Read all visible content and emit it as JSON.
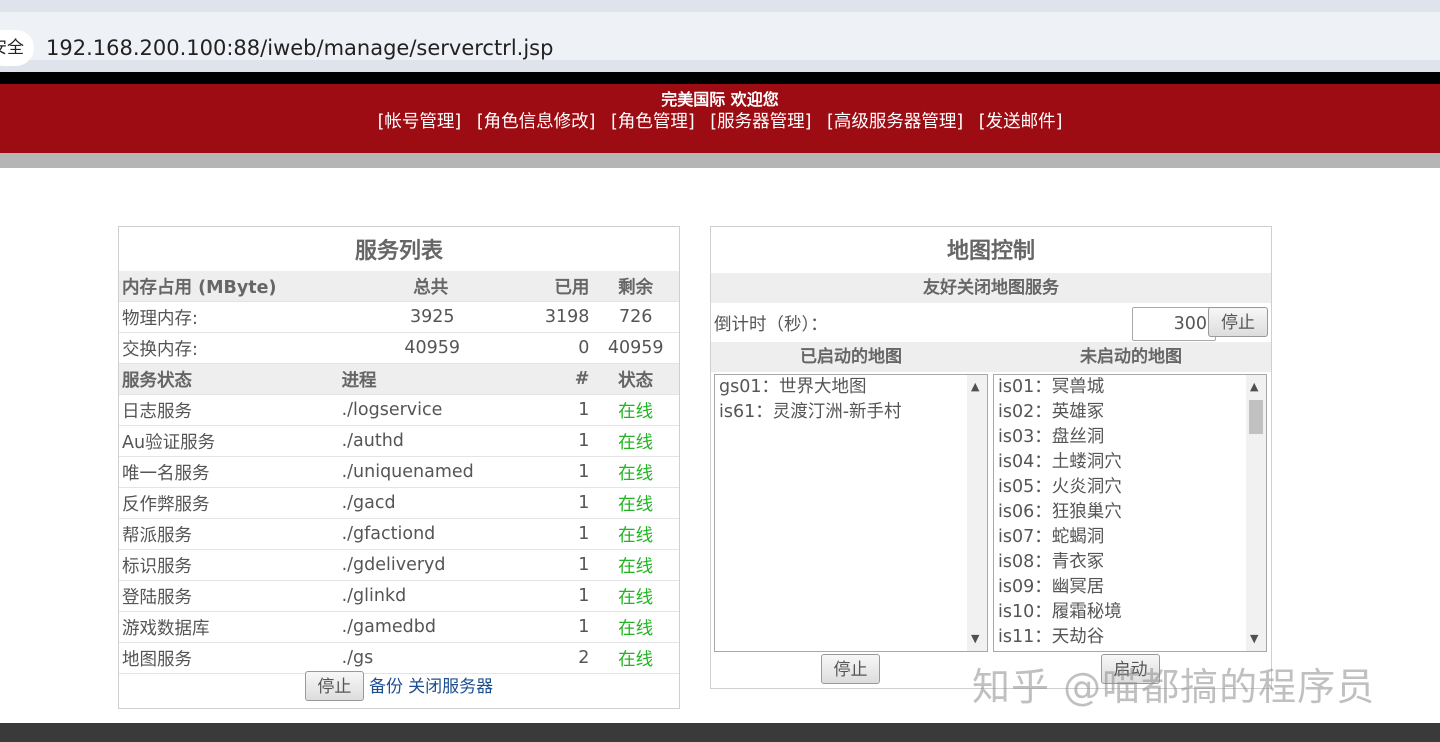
{
  "browser": {
    "secure_label": "安全",
    "url": "192.168.200.100:88/iweb/manage/serverctrl.jsp"
  },
  "header": {
    "welcome": "完美国际 欢迎您",
    "nav": [
      "[帐号管理]",
      "[角色信息修改]",
      "[角色管理]",
      "[服务器管理]",
      "[高级服务器管理]",
      "[发送邮件]"
    ]
  },
  "services": {
    "title": "服务列表",
    "memory_header": [
      "内存占用 (MByte)",
      "总共",
      "已用",
      "剩余"
    ],
    "memory_rows": [
      [
        "物理内存:",
        "3925",
        "3198",
        "726"
      ],
      [
        "交换内存:",
        "40959",
        "0",
        "40959"
      ]
    ],
    "status_header": [
      "服务状态",
      "进程",
      "#",
      "状态"
    ],
    "status_rows": [
      [
        "日志服务",
        "./logservice",
        "1",
        "在线"
      ],
      [
        "Au验证服务",
        "./authd",
        "1",
        "在线"
      ],
      [
        "唯一名服务",
        "./uniquenamed",
        "1",
        "在线"
      ],
      [
        "反作弊服务",
        "./gacd",
        "1",
        "在线"
      ],
      [
        "帮派服务",
        "./gfactiond",
        "1",
        "在线"
      ],
      [
        "标识服务",
        "./gdeliveryd",
        "1",
        "在线"
      ],
      [
        "登陆服务",
        "./glinkd",
        "1",
        "在线"
      ],
      [
        "游戏数据库",
        "./gamedbd",
        "1",
        "在线"
      ],
      [
        "地图服务",
        "./gs",
        "2",
        "在线"
      ]
    ],
    "stop_button": "停止",
    "backup_link": "备份",
    "shutdown_link": "关闭服务器",
    "online_color": "#21b521"
  },
  "maps": {
    "title": "地图控制",
    "friendly_close": "友好关闭地图服务",
    "countdown_label": "倒计时（秒）：",
    "countdown_value": "300",
    "countdown_stop": "停止",
    "started_header": "已启动的地图",
    "stopped_header": "未启动的地图",
    "started": [
      "gs01：世界大地图",
      "is61：灵渡汀洲-新手村"
    ],
    "stopped": [
      "is01：冥兽城",
      "is02：英雄冢",
      "is03：盘丝洞",
      "is04：土蝼洞穴",
      "is05：火炎洞穴",
      "is06：狂狼巢穴",
      "is07：蛇蝎洞",
      "is08：青衣冢",
      "is09：幽冥居",
      "is10：履霜秘境",
      "is11：天劫谷"
    ],
    "started_stop": "停止",
    "stopped_start": "启动"
  },
  "watermark": "知乎 @喵都搞的程序员",
  "colors": {
    "header_red": "#9d0b13",
    "link_blue": "#1d4f8f"
  }
}
